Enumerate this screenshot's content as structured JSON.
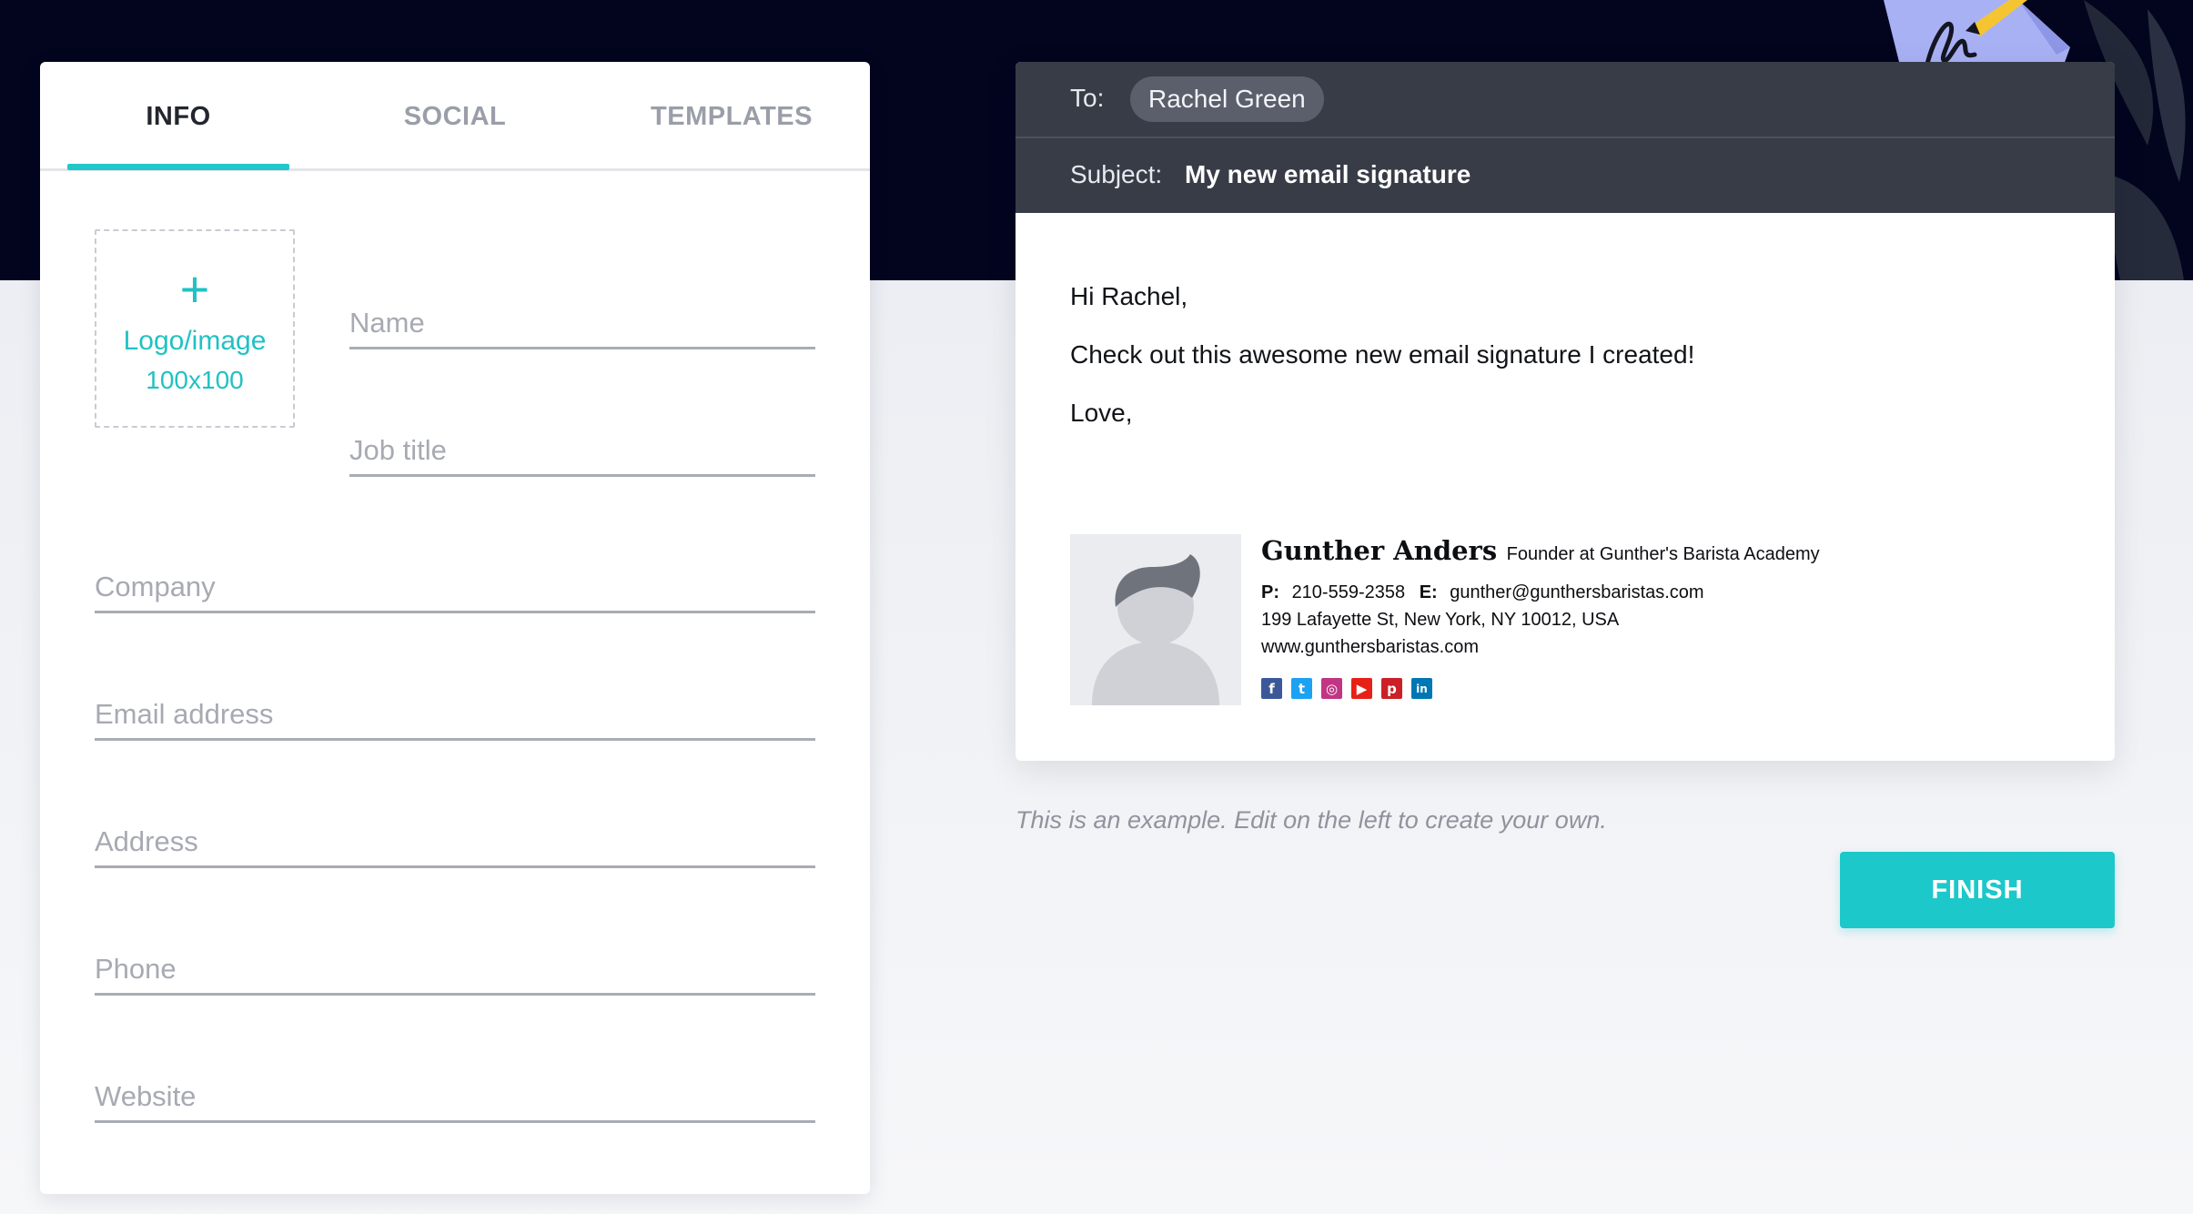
{
  "tabs": [
    {
      "label": "INFO",
      "active": true
    },
    {
      "label": "SOCIAL",
      "active": false
    },
    {
      "label": "TEMPLATES",
      "active": false
    }
  ],
  "logo_upload": {
    "plus": "+",
    "label": "Logo/image",
    "size": "100x100"
  },
  "form": {
    "name_placeholder": "Name",
    "job_title_placeholder": "Job title",
    "company_placeholder": "Company",
    "email_placeholder": "Email address",
    "address_placeholder": "Address",
    "phone_placeholder": "Phone",
    "website_placeholder": "Website"
  },
  "email": {
    "to_label": "To:",
    "recipient": "Rachel Green",
    "subject_label": "Subject:",
    "subject": "My new email signature",
    "greeting": "Hi Rachel,",
    "message": "Check out this awesome new email signature I created!",
    "closing": "Love,"
  },
  "signature": {
    "name": "Gunther Anders",
    "title": "Founder at Gunther's Barista Academy",
    "phone_label": "P:",
    "phone": "210-559-2358",
    "email_label": "E:",
    "email": "gunther@gunthersbaristas.com",
    "address": "199 Lafayette St, New York, NY 10012, USA",
    "website": "www.gunthersbaristas.com",
    "social_icons": [
      {
        "icon": "facebook-icon",
        "glyph": "f",
        "color": "#3b5998"
      },
      {
        "icon": "twitter-icon",
        "glyph": "t",
        "color": "#1da1f2"
      },
      {
        "icon": "instagram-icon",
        "glyph": "◎",
        "color": "#c13584"
      },
      {
        "icon": "youtube-icon",
        "glyph": "▶",
        "color": "#e62117"
      },
      {
        "icon": "pinterest-icon",
        "glyph": "p",
        "color": "#cb2027"
      },
      {
        "icon": "linkedin-icon",
        "glyph": "in",
        "color": "#0077b5"
      }
    ]
  },
  "example_note": "This is an example. Edit on the left to create your own.",
  "finish_label": "FINISH",
  "colors": {
    "accent": "#1cc8ca",
    "header_dark": "#03051f",
    "email_header": "#373c47"
  }
}
